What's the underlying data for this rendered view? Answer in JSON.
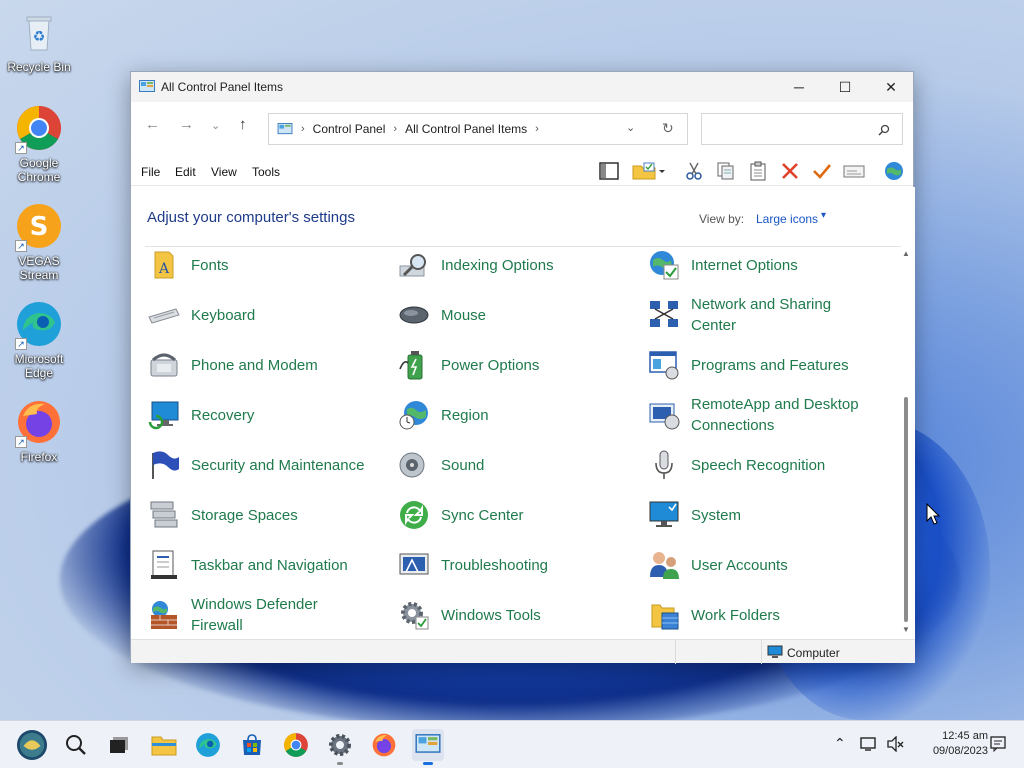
{
  "desktop": {
    "icons": [
      {
        "label": "Recycle Bin",
        "icon": "recycle-bin-icon"
      },
      {
        "label": "Google Chrome",
        "icon": "chrome-icon"
      },
      {
        "label": "VEGAS Stream",
        "icon": "vegas-stream-icon"
      },
      {
        "label": "Microsoft Edge",
        "icon": "edge-icon"
      },
      {
        "label": "Firefox",
        "icon": "firefox-icon"
      }
    ]
  },
  "window": {
    "title": "All Control Panel Items",
    "controls": {
      "minimize": "─",
      "maximize": "☐",
      "close": "✕"
    },
    "address": {
      "crumbs": [
        "Control Panel",
        "All Control Panel Items"
      ],
      "separator": "›"
    },
    "search": {
      "placeholder": ""
    },
    "menu": [
      "File",
      "Edit",
      "View",
      "Tools"
    ],
    "toolbar_icons": [
      "layout-pane-icon",
      "folder-properties-icon",
      "cut-icon",
      "copy-icon",
      "paste-icon",
      "delete-icon",
      "check-icon",
      "rename-icon",
      "globe-icon"
    ],
    "heading": "Adjust your computer's settings",
    "view_by": {
      "label": "View by:",
      "value": "Large icons"
    },
    "items": [
      [
        "Fonts",
        "Indexing Options",
        "Internet Options"
      ],
      [
        "Keyboard",
        "Mouse",
        "Network and Sharing Center"
      ],
      [
        "Phone and Modem",
        "Power Options",
        "Programs and Features"
      ],
      [
        "Recovery",
        "Region",
        "RemoteApp and Desktop Connections"
      ],
      [
        "Security and Maintenance",
        "Sound",
        "Speech Recognition"
      ],
      [
        "Storage Spaces",
        "Sync Center",
        "System"
      ],
      [
        "Taskbar and Navigation",
        "Troubleshooting",
        "User Accounts"
      ],
      [
        "Windows Defender Firewall",
        "Windows Tools",
        "Work Folders"
      ]
    ],
    "status": {
      "location": "Computer"
    }
  },
  "taskbar": {
    "apps": [
      "start-icon",
      "search-icon",
      "task-view-icon",
      "file-explorer-icon",
      "edge-icon",
      "store-icon",
      "chrome-icon",
      "settings-icon",
      "firefox-icon",
      "control-panel-icon"
    ],
    "clock": {
      "time": "12:45 am",
      "date": "09/08/2023"
    }
  }
}
